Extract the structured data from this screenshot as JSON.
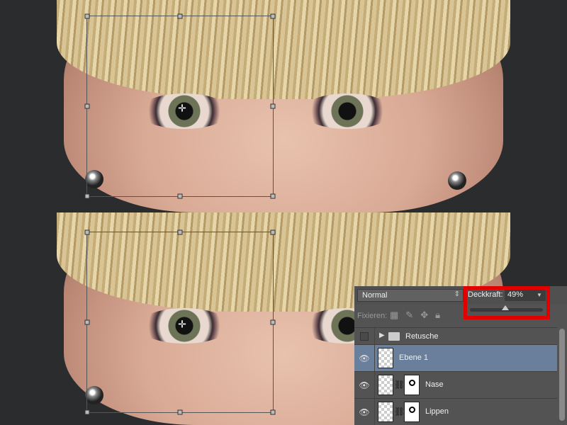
{
  "layers_panel": {
    "blend_mode": "Normal",
    "opacity_label": "Deckkraft:",
    "opacity_value": "49%",
    "opacity_percent": 49,
    "lock_label": "Fixieren:",
    "lock_icons": [
      "transparency-lock-icon",
      "brush-lock-icon",
      "move-lock-icon",
      "lock-icon"
    ],
    "layers": [
      {
        "name": "Retusche",
        "type": "group",
        "visible": false
      },
      {
        "name": "Ebene 1",
        "selected": true,
        "visible": true
      },
      {
        "name": "Nase",
        "has_mask": true,
        "visible": true
      },
      {
        "name": "Lippen",
        "has_mask": true,
        "visible": true
      }
    ]
  },
  "colors": {
    "highlight": "#e00000",
    "selected_layer": "#6a7f9b",
    "panel": "#535353"
  }
}
